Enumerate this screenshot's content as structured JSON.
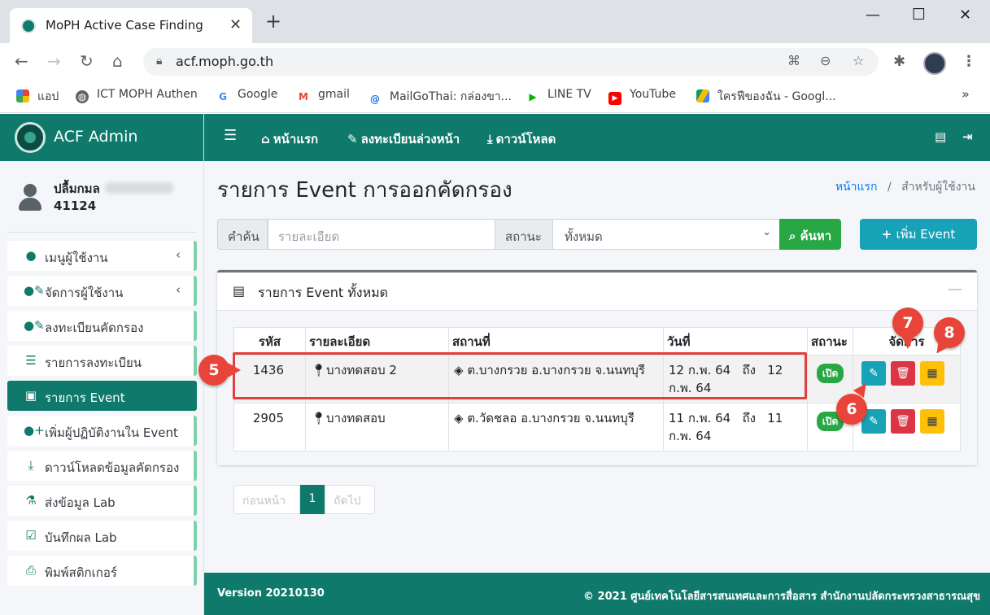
{
  "browser": {
    "tab_title": "MoPH Active Case Finding",
    "url": "acf.moph.go.th",
    "bookmarks": [
      {
        "label": "แอป",
        "icon": "apps-grid-icon"
      },
      {
        "label": "ICT MOPH Authen",
        "icon": "globe-icon"
      },
      {
        "label": "Google",
        "icon": "google-icon"
      },
      {
        "label": "gmail",
        "icon": "gmail-icon"
      },
      {
        "label": "MailGoThai: กล่องขา...",
        "icon": "mail-icon"
      },
      {
        "label": "LINE TV",
        "icon": "play-icon"
      },
      {
        "label": "YouTube",
        "icon": "youtube-icon"
      },
      {
        "label": "ใครฟีของฉัน - Googl...",
        "icon": "drive-icon"
      }
    ],
    "bookmarks_more": "»"
  },
  "app": {
    "brand": "ACF Admin",
    "accent": "#0f7a6b",
    "user": {
      "name": "ปลื้มกมล",
      "id": "41124"
    },
    "sidebar": [
      {
        "label": "เมนูผู้ใช้งาน",
        "icon": "user-icon",
        "chevron": "‹"
      },
      {
        "label": "จัดการผู้ใช้งาน",
        "icon": "user-edit-icon",
        "chevron": "‹"
      },
      {
        "label": "ลงทะเบียนคัดกรอง",
        "icon": "user-edit-icon"
      },
      {
        "label": "รายการลงทะเบียน",
        "icon": "list-icon"
      },
      {
        "label": "รายการ Event",
        "icon": "calendar-check-icon",
        "active": true
      },
      {
        "label": "เพิ่มผู้ปฏิบัติงานใน Event",
        "icon": "user-plus-icon"
      },
      {
        "label": "ดาวน์โหลดข้อมูลคัดกรอง",
        "icon": "download-icon"
      },
      {
        "label": "ส่งข้อมูล Lab",
        "icon": "test-tube-icon"
      },
      {
        "label": "บันทึกผล Lab",
        "icon": "clipboard-check-icon"
      },
      {
        "label": "พิมพ์สติกเกอร์",
        "icon": "printer-icon"
      }
    ],
    "topnav": {
      "home": "หน้าแรก",
      "preregister": "ลงทะเบียนล่วงหน้า",
      "download": "ดาวน์โหลด"
    },
    "page_title": "รายการ Event การออกคัดกรอง",
    "breadcrumb": {
      "home": "หน้าแรก",
      "sep": "/",
      "current": "สำหรับผู้ใช้งาน"
    },
    "search": {
      "label": "คำค้น",
      "placeholder": "รายละเอียด",
      "status_label": "สถานะ",
      "status_value": "ทั้งหมด",
      "button": "ค้นหา"
    },
    "add_button": "เพิ่ม Event",
    "card_title": "รายการ Event ทั้งหมด",
    "table": {
      "headers": [
        "รหัส",
        "รายละเอียด",
        "สถานที่",
        "วันที่",
        "สถานะ",
        "จัดการ"
      ],
      "rows": [
        {
          "id": "1436",
          "detail": "บางทดสอบ 2",
          "place": "ต.บางกรวย อ.บางกรวย จ.นนทบุรี",
          "date": "12 ก.พ. 64   ถึง   12 ก.พ. 64",
          "status": "เปิด"
        },
        {
          "id": "2905",
          "detail": "บางทดสอบ",
          "place": "ต.วัดชลอ อ.บางกรวย จ.นนทบุรี",
          "date": "11 ก.พ. 64   ถึง   11 ก.พ. 64",
          "status": "เปิด"
        }
      ]
    },
    "pager": {
      "prev": "ก่อนหน้า",
      "current": "1",
      "next": "ถัดไป"
    },
    "footer": {
      "version": "Version 20210130",
      "copyright": "© 2021 ศูนย์เทคโนโลยีสารสนเทศและการสื่อสาร สำนักงานปลัดกระทรวงสาธารณสุข"
    }
  },
  "annotations": {
    "c5": "5",
    "c6": "6",
    "c7": "7",
    "c8": "8",
    "color": "#e8443a"
  }
}
